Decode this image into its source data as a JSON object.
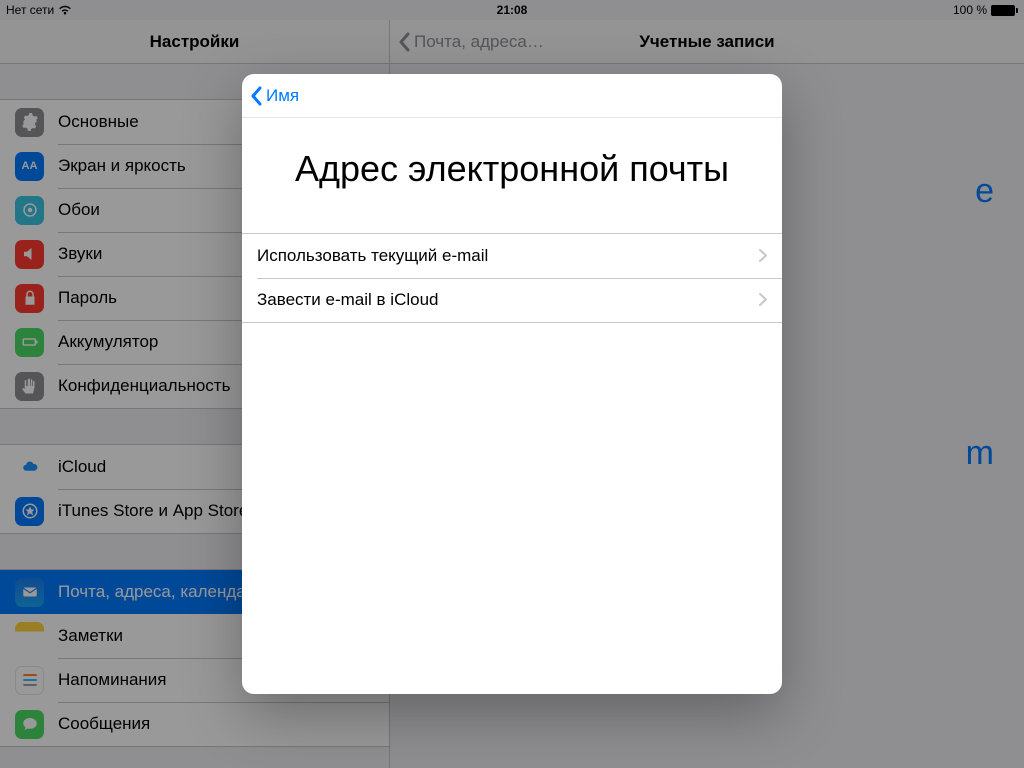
{
  "status": {
    "carrier": "Нет сети",
    "time": "21:08",
    "battery_pct": "100 %"
  },
  "master": {
    "title": "Настройки",
    "group1": [
      {
        "key": "general",
        "label": "Основные"
      },
      {
        "key": "display",
        "label": "Экран и яркость"
      },
      {
        "key": "wallpaper",
        "label": "Обои"
      },
      {
        "key": "sounds",
        "label": "Звуки"
      },
      {
        "key": "passcode",
        "label": "Пароль"
      },
      {
        "key": "battery",
        "label": "Аккумулятор"
      },
      {
        "key": "privacy",
        "label": "Конфиденциальность"
      }
    ],
    "group2": [
      {
        "key": "icloud",
        "label": "iCloud"
      },
      {
        "key": "itunes",
        "label": "iTunes Store и App Store"
      }
    ],
    "group3": [
      {
        "key": "mail",
        "label": "Почта, адреса, календари",
        "selected": true
      },
      {
        "key": "notes",
        "label": "Заметки"
      },
      {
        "key": "reminders",
        "label": "Напоминания"
      },
      {
        "key": "messages",
        "label": "Сообщения"
      }
    ]
  },
  "detail": {
    "back_label": "Почта, адреса…",
    "title": "Учетные записи",
    "peek1": "e",
    "peek2": "m"
  },
  "modal": {
    "back_label": "Имя",
    "title": "Адрес электронной почты",
    "options": [
      {
        "key": "use-current",
        "label": "Использовать текущий e-mail"
      },
      {
        "key": "get-icloud",
        "label": "Завести e-mail в iCloud"
      }
    ]
  }
}
